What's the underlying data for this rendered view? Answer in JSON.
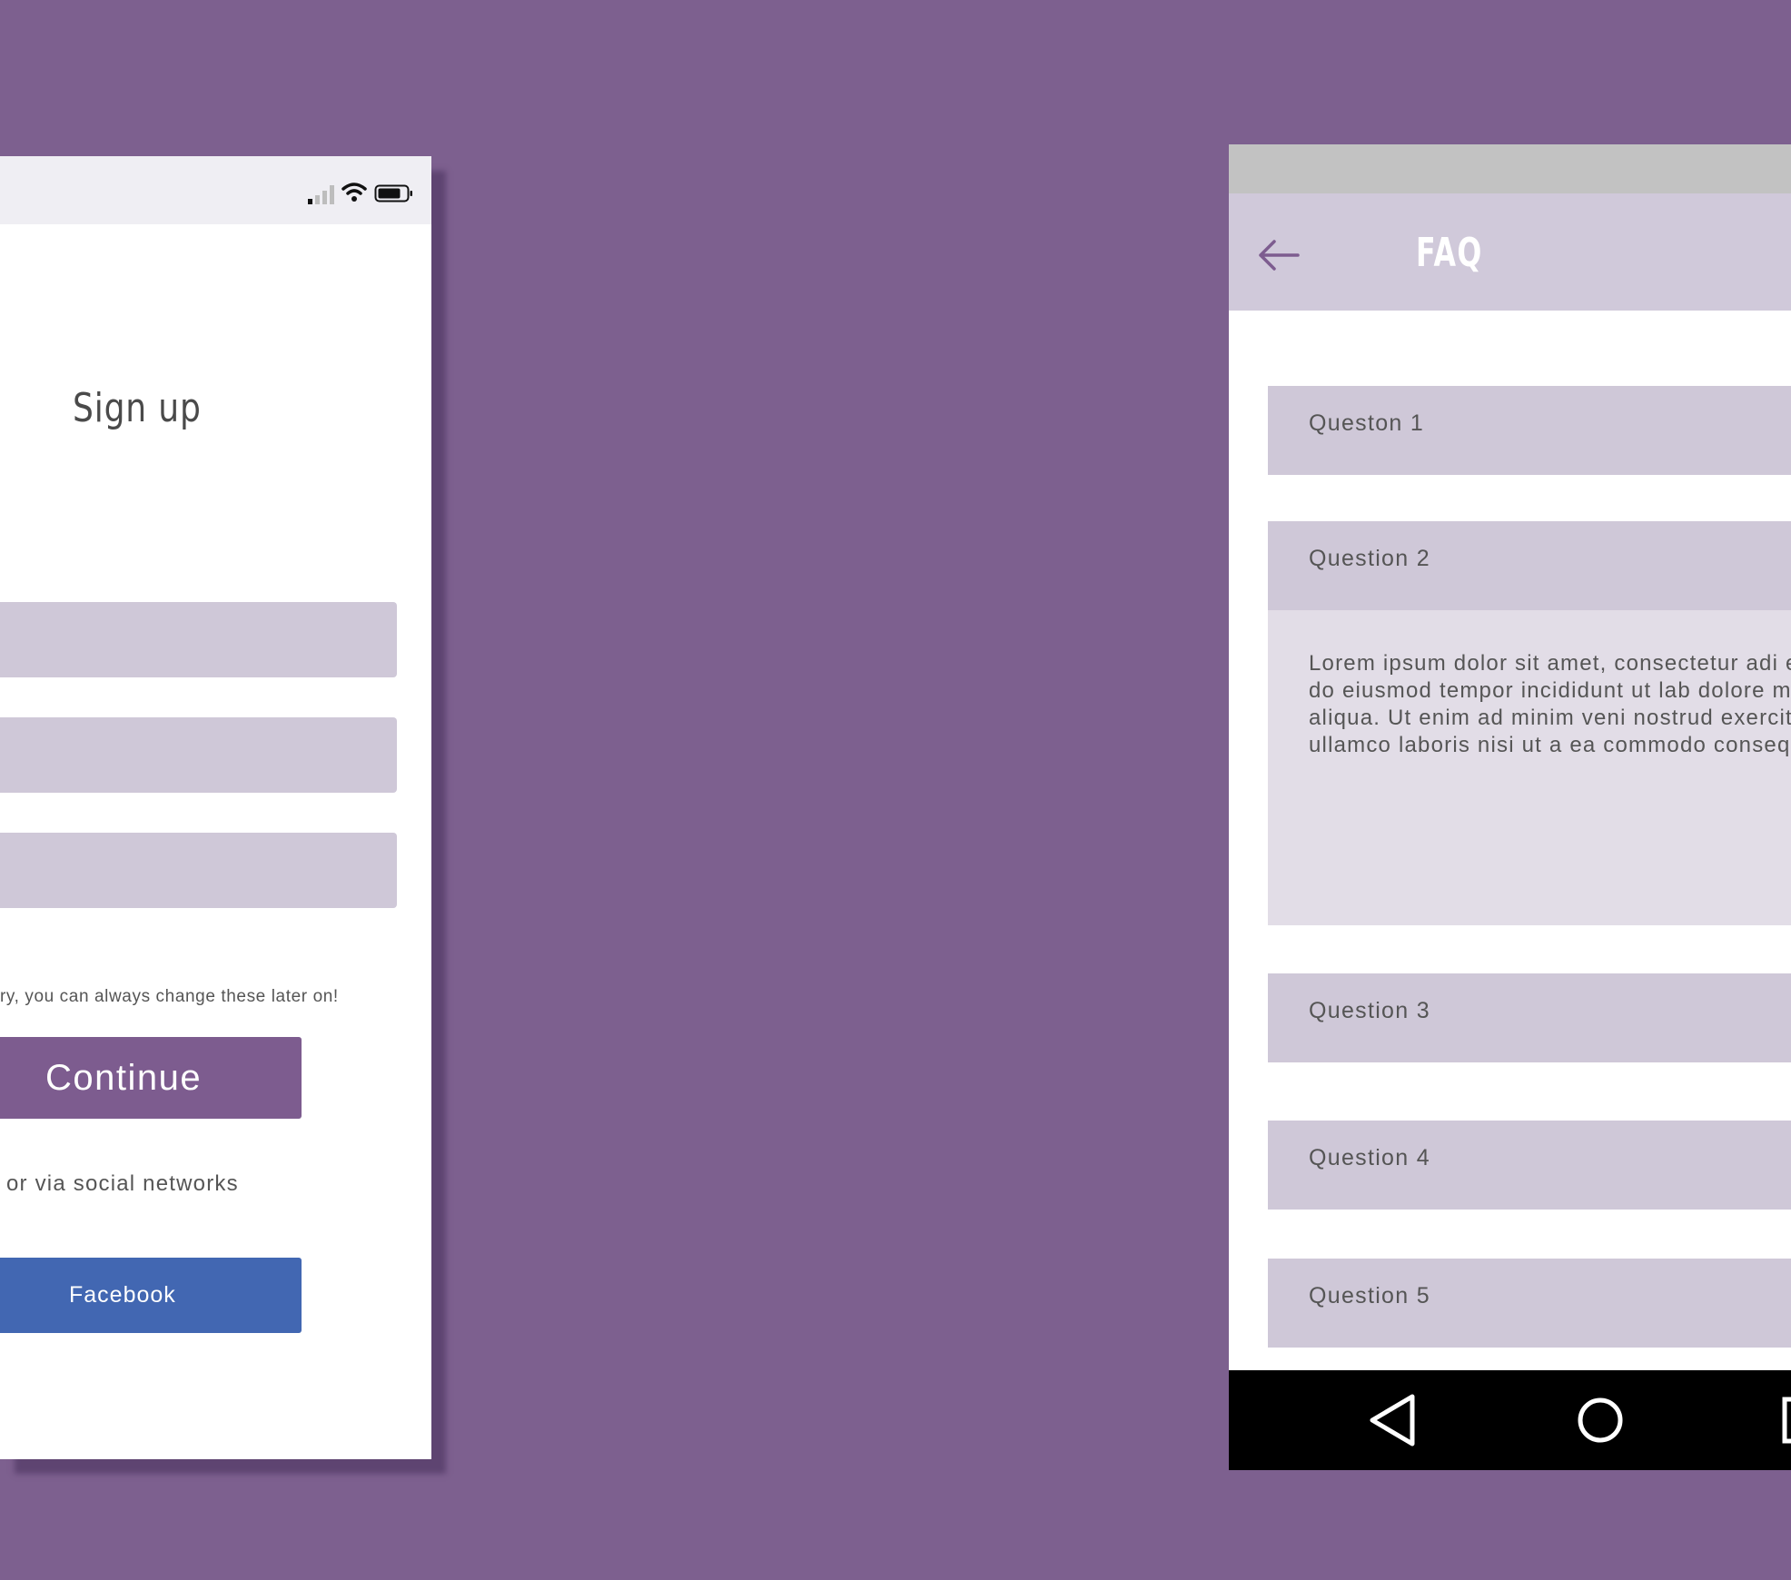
{
  "colors": {
    "background": "#7d608f",
    "accent": "#7d5c8f",
    "field": "#cfc8d8",
    "facebook": "#4267b2",
    "faq_answer": "#e2dde7",
    "appbar": "#d0c9da"
  },
  "signup_screen": {
    "status_icons": [
      "signal-icon",
      "wifi-icon",
      "battery-icon"
    ],
    "title": "Sign up",
    "fields": [
      {
        "value": "",
        "placeholder": ""
      },
      {
        "value": "",
        "placeholder": ""
      },
      {
        "value": "",
        "placeholder": ""
      }
    ],
    "hint": "ry, you can always change these later on!",
    "continue_label": "Continue",
    "social_text": "or via social networks",
    "facebook_label": "Facebook"
  },
  "faq_screen": {
    "title": "FAQ",
    "back_icon": "arrow-left-icon",
    "questions": [
      {
        "label": "Queston 1"
      },
      {
        "label": "Question 2"
      },
      {
        "label": "Question 3"
      },
      {
        "label": "Question 4"
      },
      {
        "label": "Question 5"
      }
    ],
    "answer_2": "Lorem ipsum dolor sit amet, consectetur adi elit, sed do eiusmod tempor incididunt ut lab dolore magna aliqua. Ut enim ad minim veni nostrud exercitation ullamco laboris nisi ut a ea commodo consequat.",
    "nav_icons": [
      "nav-back-icon",
      "nav-home-icon",
      "nav-recent-icon"
    ]
  }
}
